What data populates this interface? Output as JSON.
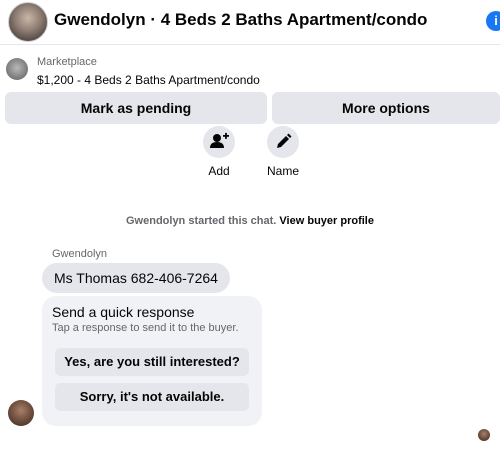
{
  "header": {
    "title": "Gwendolyn · 4 Beds 2 Baths Apartment/condo",
    "info_icon": "i"
  },
  "listing": {
    "source": "Marketplace",
    "description": "$1,200 - 4 Beds 2 Baths Apartment/condo"
  },
  "buttons": {
    "pending": "Mark as pending",
    "more": "More options"
  },
  "actions": {
    "add": "Add",
    "name": "Name"
  },
  "chat": {
    "system_text": "Gwendolyn started this chat.",
    "system_link": "View buyer profile",
    "sender": "Gwendolyn",
    "message": "Ms Thomas 682-406-7264"
  },
  "quick_response": {
    "title": "Send a quick response",
    "subtitle": "Tap a response to send it to the buyer.",
    "option1": "Yes, are you still interested?",
    "option2": "Sorry, it's not available."
  },
  "icons": {
    "add_person": "add-person-icon",
    "pencil": "pencil-icon",
    "info": "info-icon"
  },
  "colors": {
    "accent": "#1877f2",
    "button_bg": "#e4e6eb",
    "card_bg": "#f0f2f5",
    "secondary_text": "#65676b"
  }
}
